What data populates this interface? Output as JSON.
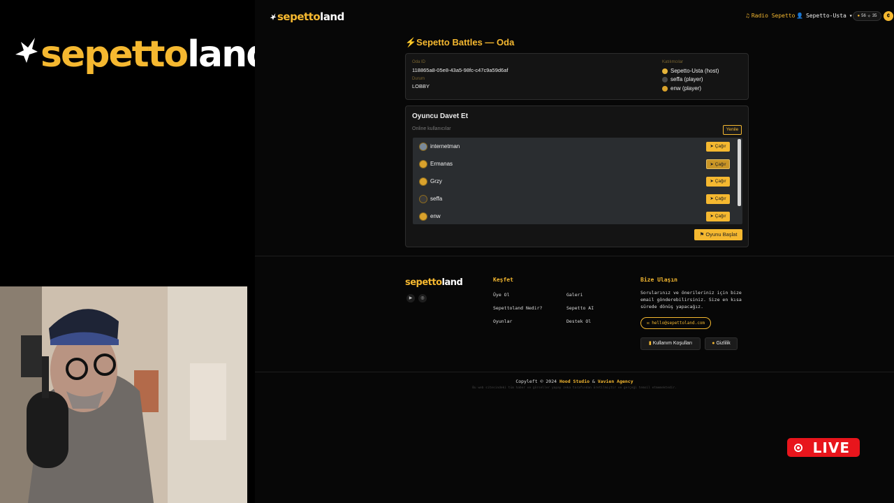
{
  "brand": {
    "logo_yellow": "sepetto",
    "logo_white": "land",
    "accent": "#f5b830"
  },
  "nav": {
    "radio_label": "Radio Sepetto",
    "user_label": "Sepetto-Usta",
    "coins": "56",
    "stars": "35"
  },
  "page_title": "⚡Sepetto Battles — Oda",
  "room": {
    "id_label": "Oda ID",
    "id_value": "118865a8-05e8-43a5-98fc-c47c9a59d6af",
    "status_label": "Durum",
    "status_value": "LOBBY",
    "participants_label": "Katılımcılar",
    "participants": [
      "Sepetto-Usta (host)",
      "seffa (player)",
      "enw (player)"
    ]
  },
  "invite": {
    "title": "Oyuncu Davet Et",
    "subtitle": "Online kullanıcılar",
    "refresh_label": "Yenile",
    "invite_label": "Çağır",
    "users": [
      "internetman",
      "Ermanas",
      "Grzy",
      "seffa",
      "enw"
    ],
    "start_label": "Oyunu Başlat"
  },
  "footer": {
    "logo_yellow": "sepetto",
    "logo_white": "land",
    "explore_title": "Keşfet",
    "links_col1": [
      "Üye Ol",
      "Sepettoland Nedir?",
      "Oyunlar"
    ],
    "links_col2": [
      "Galeri",
      "Sepetto AI",
      "Destek Ol"
    ],
    "contact_title": "Bize Ulaşın",
    "contact_text": "Sorularınız ve önerileriniz için bize email gönderebilirsiniz. Size en kısa sürede dönüş yapacağız.",
    "email": "hello@sepettoland.com",
    "terms_label": "Kullanım Koşulları",
    "privacy_label": "Gizlilik",
    "copyright_prefix": "Copyleft © 2024 ",
    "studio": "Hood Studio",
    "amp": " & ",
    "agency": "Vavien Agency",
    "disclaimer": "Bu web sitesindeki tüm haber ve görseller yapay zeka tarafından üretilmiştir ve gerçeği temsil etmemektedir."
  },
  "overlay": {
    "live_label": "LIVE"
  }
}
